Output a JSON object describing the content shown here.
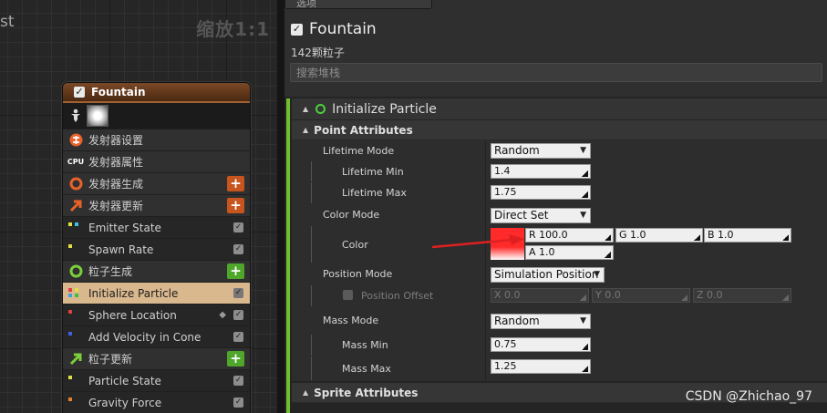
{
  "graph": {
    "title_fragment": "st",
    "zoom": "缩放1:1",
    "node": {
      "title": "Fountain",
      "rows": [
        {
          "label": "发射器设置",
          "kind": "section"
        },
        {
          "label": "发射器属性",
          "kind": "section"
        },
        {
          "label": "发射器生成",
          "kind": "section"
        },
        {
          "label": "发射器更新",
          "kind": "section"
        },
        {
          "label": "Emitter State",
          "kind": "module"
        },
        {
          "label": "Spawn Rate",
          "kind": "module"
        },
        {
          "label": "粒子生成",
          "kind": "section"
        },
        {
          "label": "Initialize Particle",
          "kind": "module-selected"
        },
        {
          "label": "Sphere Location",
          "kind": "module"
        },
        {
          "label": "Add Velocity in Cone",
          "kind": "module"
        },
        {
          "label": "粒子更新",
          "kind": "section"
        },
        {
          "label": "Particle State",
          "kind": "module"
        },
        {
          "label": "Gravity Force",
          "kind": "module"
        }
      ],
      "cpu_label": "CPU",
      "add_symbol": "+",
      "check_symbol": "✓"
    }
  },
  "details": {
    "tab_label": "选项",
    "emitter_name": "Fountain",
    "particle_count": "142颗粒子",
    "search_placeholder": "搜索堆栈",
    "module_title": "Initialize Particle",
    "categories": {
      "point": "Point Attributes",
      "sprite": "Sprite Attributes"
    },
    "props": {
      "lifetime_mode": {
        "label": "Lifetime Mode",
        "value": "Random"
      },
      "lifetime_min": {
        "label": "Lifetime Min",
        "value": "1.4"
      },
      "lifetime_max": {
        "label": "Lifetime Max",
        "value": "1.75"
      },
      "color_mode": {
        "label": "Color Mode",
        "value": "Direct Set"
      },
      "color": {
        "label": "Color",
        "r": "R 100.0",
        "g": "G 1.0",
        "b": "B 1.0",
        "a": "A 1.0",
        "swatch_color": "#ff2a2a"
      },
      "position_mode": {
        "label": "Position Mode",
        "value": "Simulation Position"
      },
      "position_offset": {
        "label": "Position Offset",
        "x": "X 0.0",
        "y": "Y 0.0",
        "z": "Z 0.0"
      },
      "mass_mode": {
        "label": "Mass Mode",
        "value": "Random"
      },
      "mass_min": {
        "label": "Mass Min",
        "value": "0.75"
      },
      "mass_max": {
        "label": "Mass Max",
        "value": "1.25"
      }
    }
  },
  "watermark": "CSDN @Zhichao_97",
  "colors": {
    "accent_green": "#6fbf2c",
    "node_header": "#5e3418",
    "selected_row": "#d9b88e",
    "annotation_arrow": "#e02020"
  }
}
